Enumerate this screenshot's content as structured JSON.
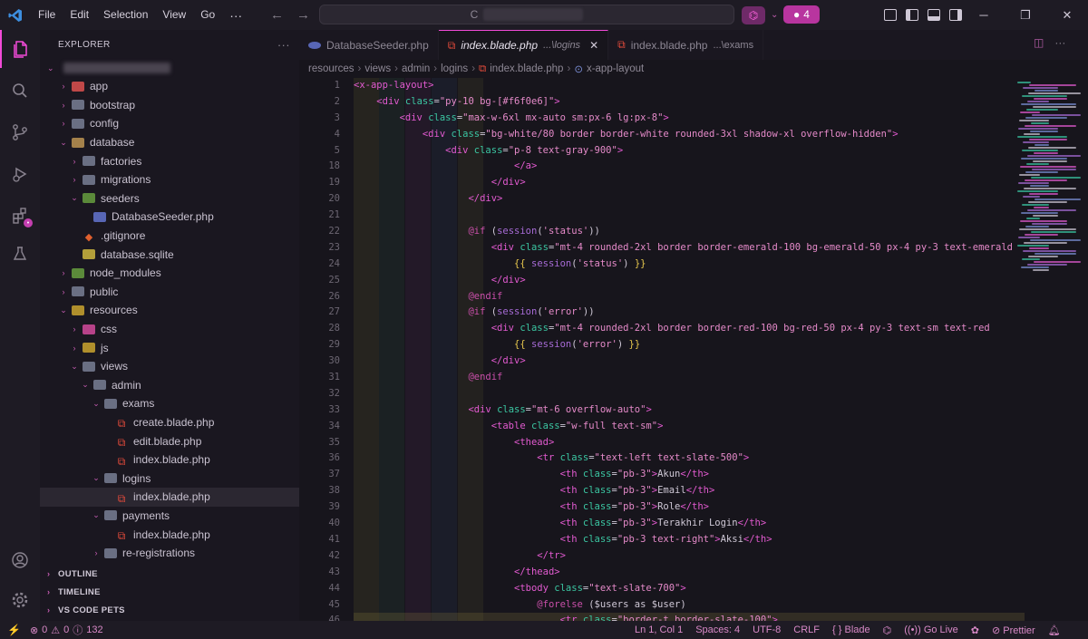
{
  "titlebar": {
    "menu": [
      "File",
      "Edit",
      "Selection",
      "View",
      "Go"
    ],
    "more": "···",
    "search_prefix": "C",
    "notification_count": "4"
  },
  "explorer": {
    "title": "EXPLORER",
    "tree": [
      {
        "label": "app",
        "depth": 1,
        "chev": "›",
        "icon": "folder-app"
      },
      {
        "label": "bootstrap",
        "depth": 1,
        "chev": "›",
        "icon": "folder"
      },
      {
        "label": "config",
        "depth": 1,
        "chev": "›",
        "icon": "folder"
      },
      {
        "label": "database",
        "depth": 1,
        "chev": "⌄",
        "icon": "folder-db"
      },
      {
        "label": "factories",
        "depth": 2,
        "chev": "›",
        "icon": "folder"
      },
      {
        "label": "migrations",
        "depth": 2,
        "chev": "›",
        "icon": "folder"
      },
      {
        "label": "seeders",
        "depth": 2,
        "chev": "⌄",
        "icon": "folder-node"
      },
      {
        "label": "DatabaseSeeder.php",
        "depth": 3,
        "chev": "",
        "icon": "php"
      },
      {
        "label": ".gitignore",
        "depth": 2,
        "chev": "",
        "icon": "git"
      },
      {
        "label": "database.sqlite",
        "depth": 2,
        "chev": "",
        "icon": "sqlite"
      },
      {
        "label": "node_modules",
        "depth": 1,
        "chev": "›",
        "icon": "folder-node"
      },
      {
        "label": "public",
        "depth": 1,
        "chev": "›",
        "icon": "folder"
      },
      {
        "label": "resources",
        "depth": 1,
        "chev": "⌄",
        "icon": "folder-res"
      },
      {
        "label": "css",
        "depth": 2,
        "chev": "›",
        "icon": "folder-pink"
      },
      {
        "label": "js",
        "depth": 2,
        "chev": "›",
        "icon": "folder-res"
      },
      {
        "label": "views",
        "depth": 2,
        "chev": "⌄",
        "icon": "folder"
      },
      {
        "label": "admin",
        "depth": 3,
        "chev": "⌄",
        "icon": "folder"
      },
      {
        "label": "exams",
        "depth": 4,
        "chev": "⌄",
        "icon": "folder"
      },
      {
        "label": "create.blade.php",
        "depth": 5,
        "chev": "",
        "icon": "laravel"
      },
      {
        "label": "edit.blade.php",
        "depth": 5,
        "chev": "",
        "icon": "laravel"
      },
      {
        "label": "index.blade.php",
        "depth": 5,
        "chev": "",
        "icon": "laravel"
      },
      {
        "label": "logins",
        "depth": 4,
        "chev": "⌄",
        "icon": "folder"
      },
      {
        "label": "index.blade.php",
        "depth": 5,
        "chev": "",
        "icon": "laravel",
        "selected": true
      },
      {
        "label": "payments",
        "depth": 4,
        "chev": "⌄",
        "icon": "folder"
      },
      {
        "label": "index.blade.php",
        "depth": 5,
        "chev": "",
        "icon": "laravel"
      },
      {
        "label": "re-registrations",
        "depth": 4,
        "chev": "›",
        "icon": "folder"
      }
    ],
    "sections": [
      "OUTLINE",
      "TIMELINE",
      "VS CODE PETS"
    ]
  },
  "tabs": [
    {
      "label": "DatabaseSeeder.php",
      "desc": "",
      "icon": "php",
      "active": false
    },
    {
      "label": "index.blade.php",
      "desc": "...\\logins",
      "icon": "laravel",
      "active": true
    },
    {
      "label": "index.blade.php",
      "desc": "...\\exams",
      "icon": "laravel",
      "active": false
    }
  ],
  "breadcrumb": [
    "resources",
    "views",
    "admin",
    "logins",
    "index.blade.php",
    "x-app-layout"
  ],
  "editor": {
    "lines": [
      {
        "n": "1",
        "indent": 0,
        "html": "<span class='tok-tag'>&lt;x-app-layout&gt;</span>"
      },
      {
        "n": "2",
        "indent": 4,
        "html": "<span class='tok-tag'>&lt;div</span> <span class='tok-attr'>class</span>=<span class='tok-str'>\"py-10 bg-[#f6f0e6]\"</span><span class='tok-tag'>&gt;</span>"
      },
      {
        "n": "3",
        "indent": 8,
        "html": "<span class='tok-tag'>&lt;div</span> <span class='tok-attr'>class</span>=<span class='tok-str'>\"max-w-6xl mx-auto sm:px-6 lg:px-8\"</span><span class='tok-tag'>&gt;</span>"
      },
      {
        "n": "4",
        "indent": 12,
        "html": "<span class='tok-tag'>&lt;div</span> <span class='tok-attr'>class</span>=<span class='tok-str'>\"bg-white/80 border border-white rounded-3xl shadow-xl overflow-hidden\"</span><span class='tok-tag'>&gt;</span>"
      },
      {
        "n": "5",
        "indent": 16,
        "html": "<span class='tok-tag'>&lt;div</span> <span class='tok-attr'>class</span>=<span class='tok-str'>\"p-8 text-gray-900\"</span><span class='tok-tag'>&gt;</span>"
      },
      {
        "n": "18",
        "indent": 28,
        "html": "<span class='tok-tag'>&lt;/a&gt;</span>"
      },
      {
        "n": "19",
        "indent": 24,
        "html": "<span class='tok-tag'>&lt;/div&gt;</span>"
      },
      {
        "n": "20",
        "indent": 20,
        "html": "<span class='tok-tag'>&lt;/div&gt;</span>"
      },
      {
        "n": "21",
        "indent": 0,
        "html": ""
      },
      {
        "n": "22",
        "indent": 20,
        "html": "<span class='tok-dir'>@if</span> (<span class='tok-fn'>session</span>(<span class='tok-str'>'status'</span>))"
      },
      {
        "n": "23",
        "indent": 24,
        "html": "<span class='tok-tag'>&lt;div</span> <span class='tok-attr'>class</span>=<span class='tok-str'>\"mt-4 rounded-2xl border border-emerald-100 bg-emerald-50 px-4 py-3 text-emerald</span>"
      },
      {
        "n": "24",
        "indent": 28,
        "html": "<span class='tok-brace'>{{</span> <span class='tok-fn'>session</span>(<span class='tok-str'>'status'</span>) <span class='tok-brace'>}}</span>"
      },
      {
        "n": "25",
        "indent": 24,
        "html": "<span class='tok-tag'>&lt;/div&gt;</span>"
      },
      {
        "n": "26",
        "indent": 20,
        "html": "<span class='tok-dir'>@endif</span>"
      },
      {
        "n": "27",
        "indent": 20,
        "html": "<span class='tok-dir'>@if</span> (<span class='tok-fn'>session</span>(<span class='tok-str'>'error'</span>))"
      },
      {
        "n": "28",
        "indent": 24,
        "html": "<span class='tok-tag'>&lt;div</span> <span class='tok-attr'>class</span>=<span class='tok-str'>\"mt-4 rounded-2xl border border-red-100 bg-red-50 px-4 py-3 text-sm text-red</span>"
      },
      {
        "n": "29",
        "indent": 28,
        "html": "<span class='tok-brace'>{{</span> <span class='tok-fn'>session</span>(<span class='tok-str'>'error'</span>) <span class='tok-brace'>}}</span>"
      },
      {
        "n": "30",
        "indent": 24,
        "html": "<span class='tok-tag'>&lt;/div&gt;</span>"
      },
      {
        "n": "31",
        "indent": 20,
        "html": "<span class='tok-dir'>@endif</span>"
      },
      {
        "n": "32",
        "indent": 0,
        "html": ""
      },
      {
        "n": "33",
        "indent": 20,
        "html": "<span class='tok-tag'>&lt;div</span> <span class='tok-attr'>class</span>=<span class='tok-str'>\"mt-6 overflow-auto\"</span><span class='tok-tag'>&gt;</span>"
      },
      {
        "n": "34",
        "indent": 24,
        "html": "<span class='tok-tag'>&lt;table</span> <span class='tok-attr'>class</span>=<span class='tok-str'>\"w-full text-sm\"</span><span class='tok-tag'>&gt;</span>"
      },
      {
        "n": "35",
        "indent": 28,
        "html": "<span class='tok-tag'>&lt;thead&gt;</span>"
      },
      {
        "n": "36",
        "indent": 32,
        "html": "<span class='tok-tag'>&lt;tr</span> <span class='tok-attr'>class</span>=<span class='tok-str'>\"text-left text-slate-500\"</span><span class='tok-tag'>&gt;</span>"
      },
      {
        "n": "37",
        "indent": 36,
        "html": "<span class='tok-tag'>&lt;th</span> <span class='tok-attr'>class</span>=<span class='tok-str'>\"pb-3\"</span><span class='tok-tag'>&gt;</span>Akun<span class='tok-tag'>&lt;/th&gt;</span>"
      },
      {
        "n": "38",
        "indent": 36,
        "html": "<span class='tok-tag'>&lt;th</span> <span class='tok-attr'>class</span>=<span class='tok-str'>\"pb-3\"</span><span class='tok-tag'>&gt;</span>Email<span class='tok-tag'>&lt;/th&gt;</span>"
      },
      {
        "n": "39",
        "indent": 36,
        "html": "<span class='tok-tag'>&lt;th</span> <span class='tok-attr'>class</span>=<span class='tok-str'>\"pb-3\"</span><span class='tok-tag'>&gt;</span>Role<span class='tok-tag'>&lt;/th&gt;</span>"
      },
      {
        "n": "40",
        "indent": 36,
        "html": "<span class='tok-tag'>&lt;th</span> <span class='tok-attr'>class</span>=<span class='tok-str'>\"pb-3\"</span><span class='tok-tag'>&gt;</span>Terakhir Login<span class='tok-tag'>&lt;/th&gt;</span>"
      },
      {
        "n": "41",
        "indent": 36,
        "html": "<span class='tok-tag'>&lt;th</span> <span class='tok-attr'>class</span>=<span class='tok-str'>\"pb-3 text-right\"</span><span class='tok-tag'>&gt;</span>Aksi<span class='tok-tag'>&lt;/th&gt;</span>"
      },
      {
        "n": "42",
        "indent": 32,
        "html": "<span class='tok-tag'>&lt;/tr&gt;</span>"
      },
      {
        "n": "43",
        "indent": 28,
        "html": "<span class='tok-tag'>&lt;/thead&gt;</span>"
      },
      {
        "n": "44",
        "indent": 28,
        "html": "<span class='tok-tag'>&lt;tbody</span> <span class='tok-attr'>class</span>=<span class='tok-str'>\"text-slate-700\"</span><span class='tok-tag'>&gt;</span>"
      },
      {
        "n": "45",
        "indent": 32,
        "html": "<span class='tok-dir'>@forelse</span> ($users as $user)"
      },
      {
        "n": "46",
        "indent": 36,
        "html": "<span class='tok-tag'>&lt;tr</span> <span class='tok-attr'>class</span>=<span class='tok-str'>\"border-t border-slate-100\"</span><span class='tok-tag'>&gt;</span>",
        "highlight": true
      }
    ]
  },
  "statusbar": {
    "errors": "0",
    "warnings": "0",
    "info": "132",
    "cursor": "Ln 1, Col 1",
    "spaces": "Spaces: 4",
    "encoding": "UTF-8",
    "eol": "CRLF",
    "language": "Blade",
    "golive": "Go Live",
    "prettier": "Prettier"
  }
}
